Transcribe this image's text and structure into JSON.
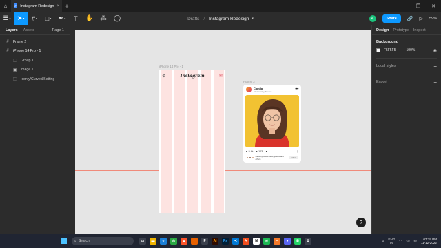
{
  "titlebar": {
    "tab_title": "Instagram Redesign",
    "add_tab": "+",
    "controls": {
      "minimize": "–",
      "maximize": "❐",
      "close": "✕"
    }
  },
  "toolbar": {
    "breadcrumb": "Drafts",
    "separator": "/",
    "file_name": "Instagram Redesign",
    "user_initial": "A",
    "share_label": "Share",
    "zoom": "59%"
  },
  "left_panel": {
    "tabs": [
      "Layers",
      "Assets"
    ],
    "page": "Page 1",
    "layers": [
      {
        "label": "Frame 2",
        "icon": "frame-icon",
        "child": false
      },
      {
        "label": "iPhone 14 Pro - 1",
        "icon": "frame-icon",
        "child": false
      },
      {
        "label": "Group 1",
        "icon": "group-icon",
        "child": true
      },
      {
        "label": "image 1",
        "icon": "image-icon",
        "child": true
      },
      {
        "label": "Iconly/Curved/Setting",
        "icon": "component-icon",
        "child": true
      }
    ]
  },
  "canvas": {
    "iphone_label": "iPhone 14 Pro - 1",
    "frame2_label": "Frame 2",
    "insta_logo": "Instagram",
    "post": {
      "username": "Camila",
      "location": "Mexico City, Mexico",
      "likes": "5.4k",
      "comments": "103",
      "liked_by": "Liked by maria.flores, jose.m and others",
      "follow_label": "Follow"
    },
    "help": "?"
  },
  "right_panel": {
    "tabs": [
      "Design",
      "Prototype",
      "Inspect"
    ],
    "background_title": "Background",
    "bg_color": "F5F5F5",
    "bg_opacity": "100%",
    "local_styles": "Local styles",
    "export": "Export"
  },
  "taskbar": {
    "search_label": "Search",
    "lang_top": "ENG",
    "lang_bottom": "IN",
    "time": "07:19 PM",
    "date": "11-12-2022"
  },
  "colors": {
    "accent": "#0d99ff",
    "column_guide": "#fde3e1",
    "post_bg": "#f2c232",
    "guide_line": "#f08a7a"
  }
}
